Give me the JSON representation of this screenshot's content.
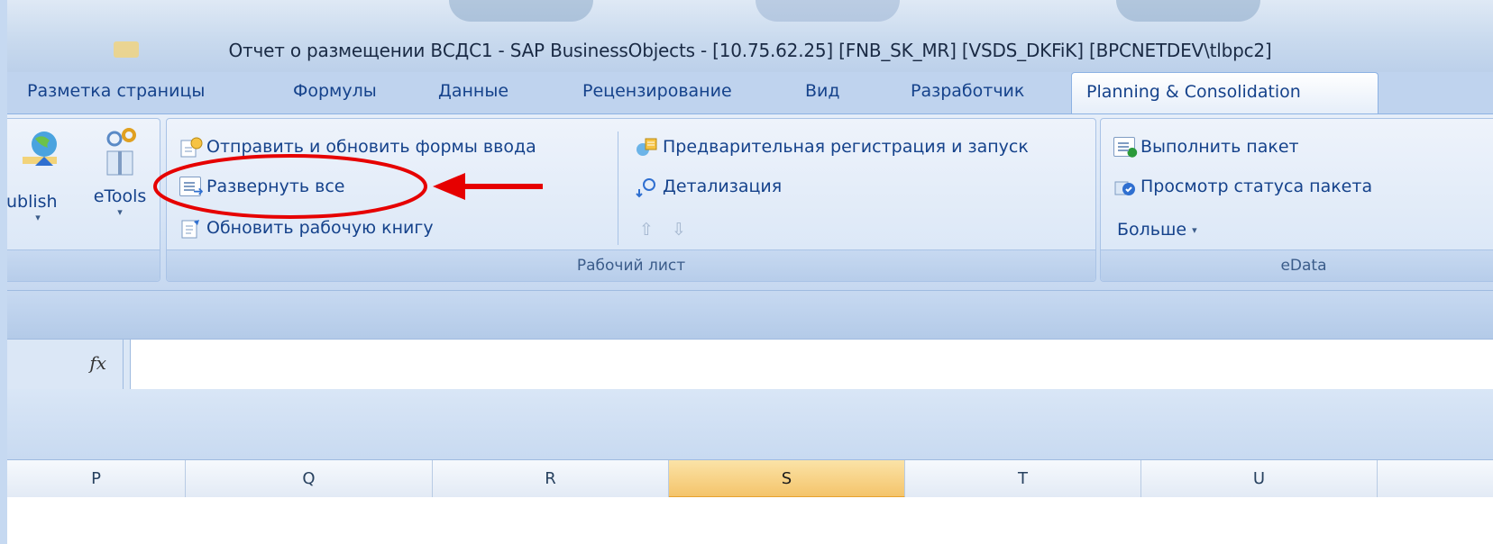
{
  "window": {
    "title": "Отчет о размещении ВСДС1  - SAP BusinessObjects  - [10.75.62.25] [FNB_SK_MR] [VSDS_DKFiK] [BPCNETDEV\\tlbpc2]"
  },
  "tabs": [
    {
      "label": "Разметка страницы"
    },
    {
      "label": "Формулы"
    },
    {
      "label": "Данные"
    },
    {
      "label": "Рецензирование"
    },
    {
      "label": "Вид"
    },
    {
      "label": "Разработчик"
    },
    {
      "label": "Planning & Consolidation",
      "active": true
    }
  ],
  "ribbon": {
    "left_buttons": {
      "publish_label": "ublish",
      "etools_label": "eTools"
    },
    "worksheet_group": {
      "label": "Рабочий лист",
      "send_refresh": "Отправить и обновить формы ввода",
      "expand_all": "Развернуть все",
      "refresh_workbook": "Обновить рабочую книгу",
      "pre_register": "Предварительная регистрация и запуск",
      "drilldown": "Детализация",
      "up_arrow": "⇧",
      "down_arrow": "⇩"
    },
    "edata_group": {
      "label": "eData",
      "run_package": "Выполнить пакет",
      "view_package_status": "Просмотр статуса пакета",
      "more": "Больше",
      "more_caret": "▾"
    }
  },
  "formula_bar": {
    "fx": "fx",
    "value": ""
  },
  "columns": [
    "P",
    "Q",
    "R",
    "S",
    "T",
    "U"
  ],
  "selected_column": "S",
  "colors": {
    "accent": "#15428b",
    "annotation": "#e60000",
    "selected_column": "#f4c46b"
  }
}
